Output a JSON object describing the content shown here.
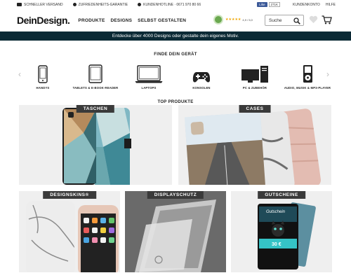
{
  "topbar": {
    "shipping": "SCHNELLER VERSAND",
    "guarantee": "ZUFRIEDENHEITS-GARANTIE",
    "hotline": "KUNDENHOTLINE · 0671 970 80 66",
    "fb_like": "Like",
    "fb_count": "271K",
    "account": "KUNDENKONTO",
    "help": "HILFE"
  },
  "header": {
    "logo": "DeinDesign.",
    "nav": [
      "PRODUKTE",
      "DESIGNS",
      "SELBST GESTALTEN"
    ],
    "rating_stars": "★★★★★",
    "rating_score": "4,9 / 5,0",
    "search_placeholder": "Suche"
  },
  "banner": "Entdecke über 4000 Designs oder gestalte dein eigenes Motiv.",
  "devices_title": "FINDE DEIN GERÄT",
  "devices": [
    {
      "label": "HANDYS",
      "icon": "smartphone-icon"
    },
    {
      "label": "TABLETS & E-BOOK-READER",
      "icon": "tablet-icon"
    },
    {
      "label": "LAPTOPS",
      "icon": "laptop-icon"
    },
    {
      "label": "KONSOLEN",
      "icon": "gamepad-icon"
    },
    {
      "label": "PC & ZUBEHÖR",
      "icon": "desktop-pc-icon"
    },
    {
      "label": "AUDIO, MUSIK & MP3-PLAYER",
      "icon": "mp3-player-icon"
    }
  ],
  "products_title": "TOP PRODUKTE",
  "products": [
    {
      "label": "TASCHEN"
    },
    {
      "label": "CASES"
    },
    {
      "label": "DESIGNSKINS®"
    },
    {
      "label": "DISPLAYSCHUTZ"
    },
    {
      "label": "GUTSCHEINE"
    }
  ],
  "voucher": {
    "title": "Gutschein",
    "amount": "30 €"
  }
}
